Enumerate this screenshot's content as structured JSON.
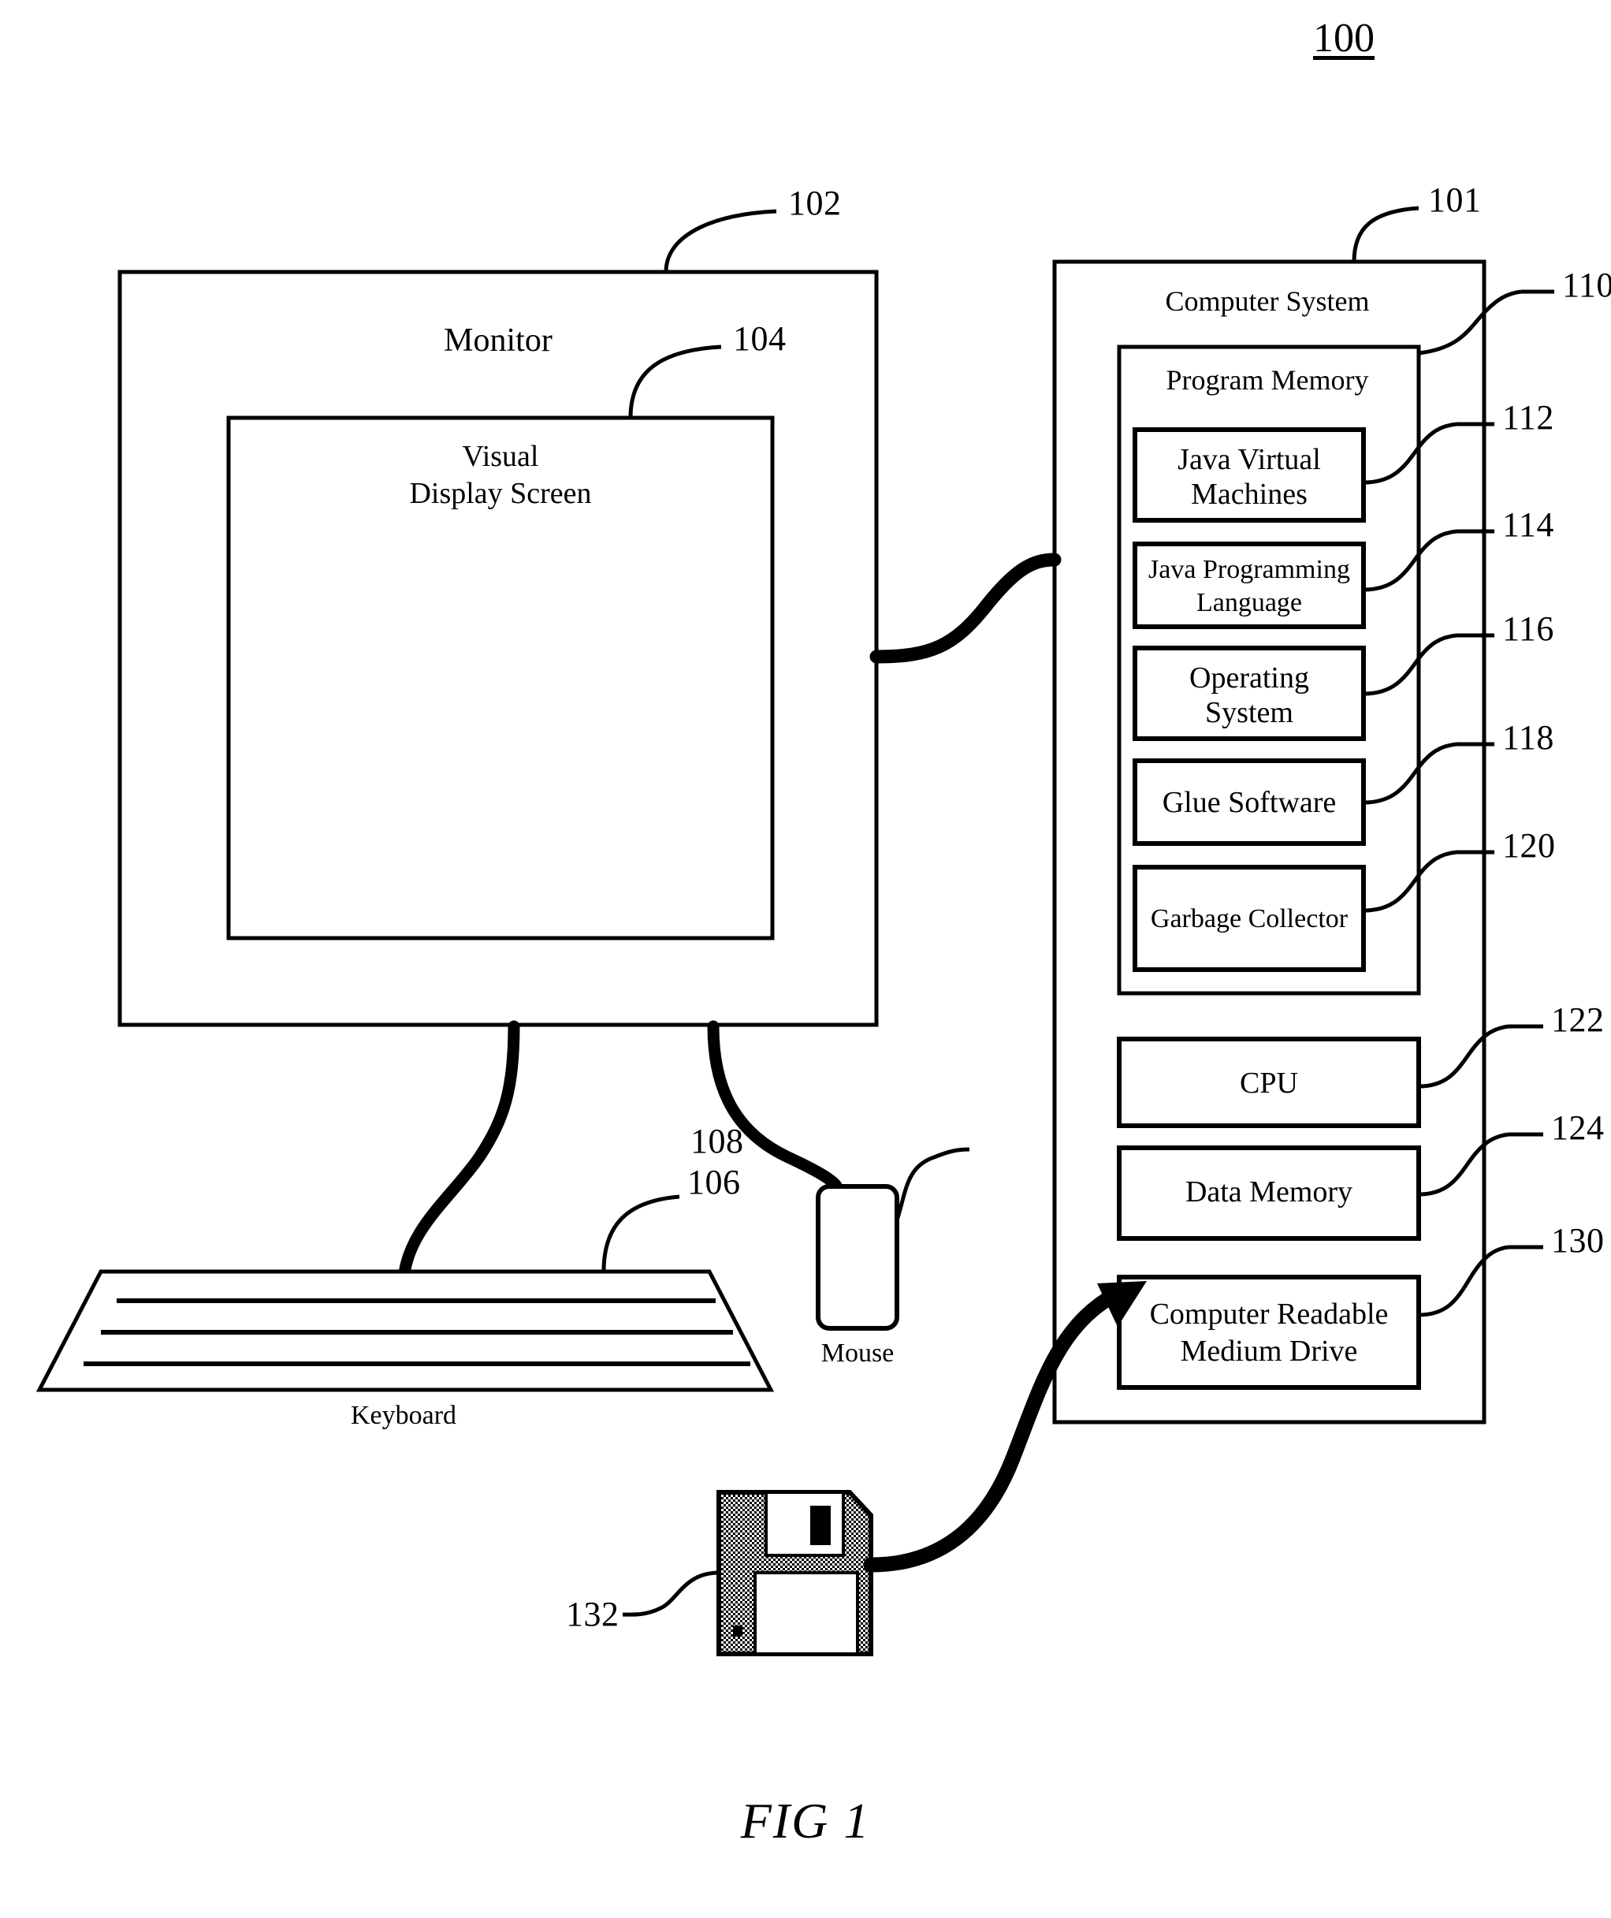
{
  "figure": {
    "number_label": "100",
    "caption": "FIG 1"
  },
  "devices": {
    "monitor": {
      "label": "Monitor",
      "ref": "102",
      "screen": {
        "label_line1": "Visual",
        "label_line2": "Display Screen",
        "ref": "104"
      }
    },
    "keyboard": {
      "label": "Keyboard",
      "ref": "106"
    },
    "mouse": {
      "label": "Mouse",
      "ref": "108"
    },
    "floppy_disk": {
      "label": "",
      "ref": "132"
    }
  },
  "computer_system": {
    "label": "Computer System",
    "ref": "101",
    "program_memory": {
      "label": "Program Memory",
      "ref": "110",
      "modules": [
        {
          "label_line1": "Java Virtual",
          "label_line2": "Machines",
          "ref": "112"
        },
        {
          "label_line1": "Java Programming",
          "label_line2": "Language",
          "ref": "114"
        },
        {
          "label_line1": "Operating",
          "label_line2": "System",
          "ref": "116"
        },
        {
          "label_line1": "Glue Software",
          "label_line2": "",
          "ref": "118"
        },
        {
          "label_line1": "Garbage Collector",
          "label_line2": "",
          "ref": "120"
        }
      ]
    },
    "components": [
      {
        "label_line1": "CPU",
        "label_line2": "",
        "ref": "122"
      },
      {
        "label_line1": "Data Memory",
        "label_line2": "",
        "ref": "124"
      },
      {
        "label_line1": "Computer Readable",
        "label_line2": "Medium Drive",
        "ref": "130"
      }
    ]
  },
  "colors": {
    "ink": "#000000",
    "paper": "#ffffff",
    "disk_shell": "#808080"
  }
}
